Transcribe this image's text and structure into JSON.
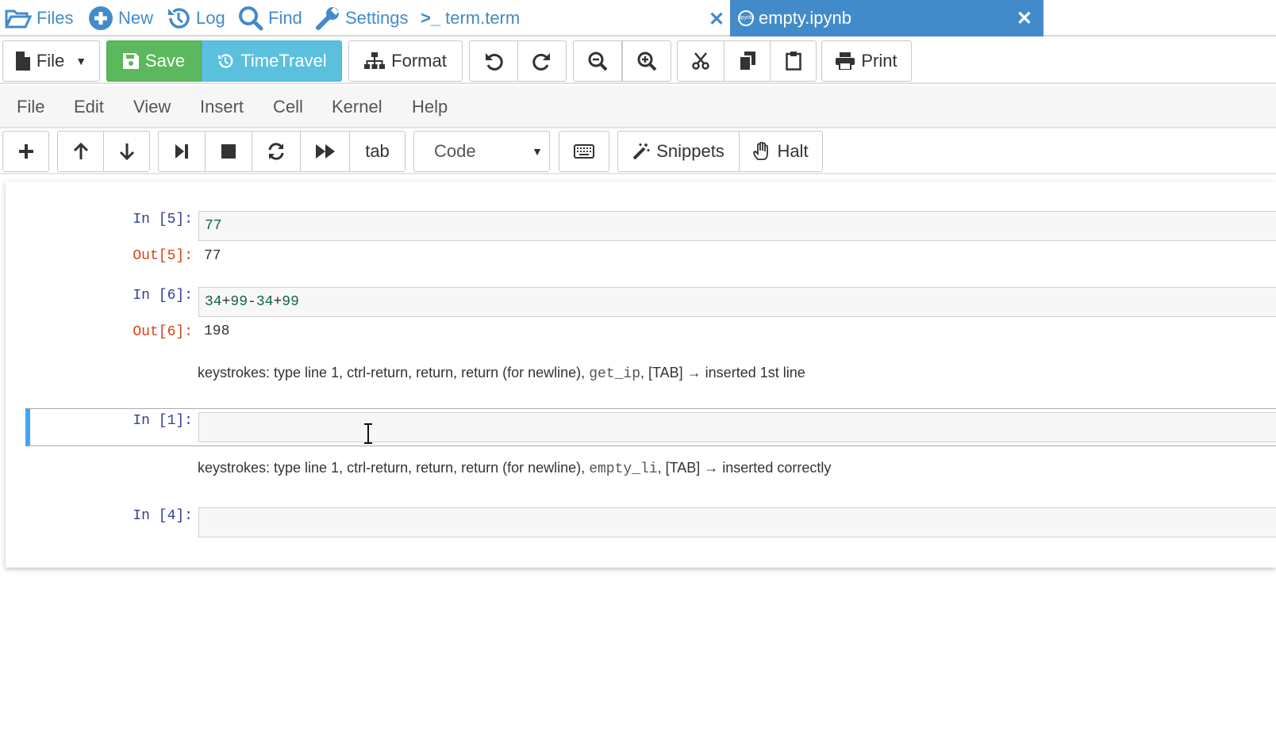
{
  "topbar": {
    "files": "Files",
    "new": "New",
    "log": "Log",
    "find": "Find",
    "settings": "Settings",
    "term_prefix": ">_",
    "term": "term.term",
    "close_left": "✕",
    "active_tab": "empty.ipynb",
    "active_tab_icon_text": "ipynb",
    "close_active": "✕"
  },
  "toolbar": {
    "file": "File",
    "save": "Save",
    "timetravel": "TimeTravel",
    "format": "Format",
    "print": "Print"
  },
  "menu": [
    "File",
    "Edit",
    "View",
    "Insert",
    "Cell",
    "Kernel",
    "Help"
  ],
  "cell_toolbar": {
    "tab": "tab",
    "cell_type": "Code",
    "snippets": "Snippets",
    "halt": "Halt"
  },
  "cells": {
    "c5": {
      "in_prompt": "In [5]:",
      "code": "77",
      "out_prompt": "Out[5]:",
      "output": "77"
    },
    "c6": {
      "in_prompt": "In [6]:",
      "code_parts": [
        "34",
        "+",
        "99",
        "-",
        "34",
        "+",
        "99"
      ],
      "out_prompt": "Out[6]:",
      "output": "198"
    },
    "md1": {
      "pre": "keystrokes: type line 1, ctrl-return, return, return (for newline), ",
      "code": "get_ip",
      "post": ", [TAB] → inserted 1st line"
    },
    "c1": {
      "in_prompt": "In [1]:"
    },
    "md2": {
      "pre": "keystrokes: type line 1, ctrl-return, return, return (for newline), ",
      "code": "empty_li",
      "post": ", [TAB] → inserted correctly"
    },
    "c4": {
      "in_prompt": "In [4]:"
    }
  },
  "colors": {
    "accent": "#428bca",
    "save": "#5cb85c",
    "timetravel": "#5bc0de",
    "in_prompt": "#303f9f",
    "out_prompt": "#d84315",
    "selected_cell": "#42a5f5"
  }
}
